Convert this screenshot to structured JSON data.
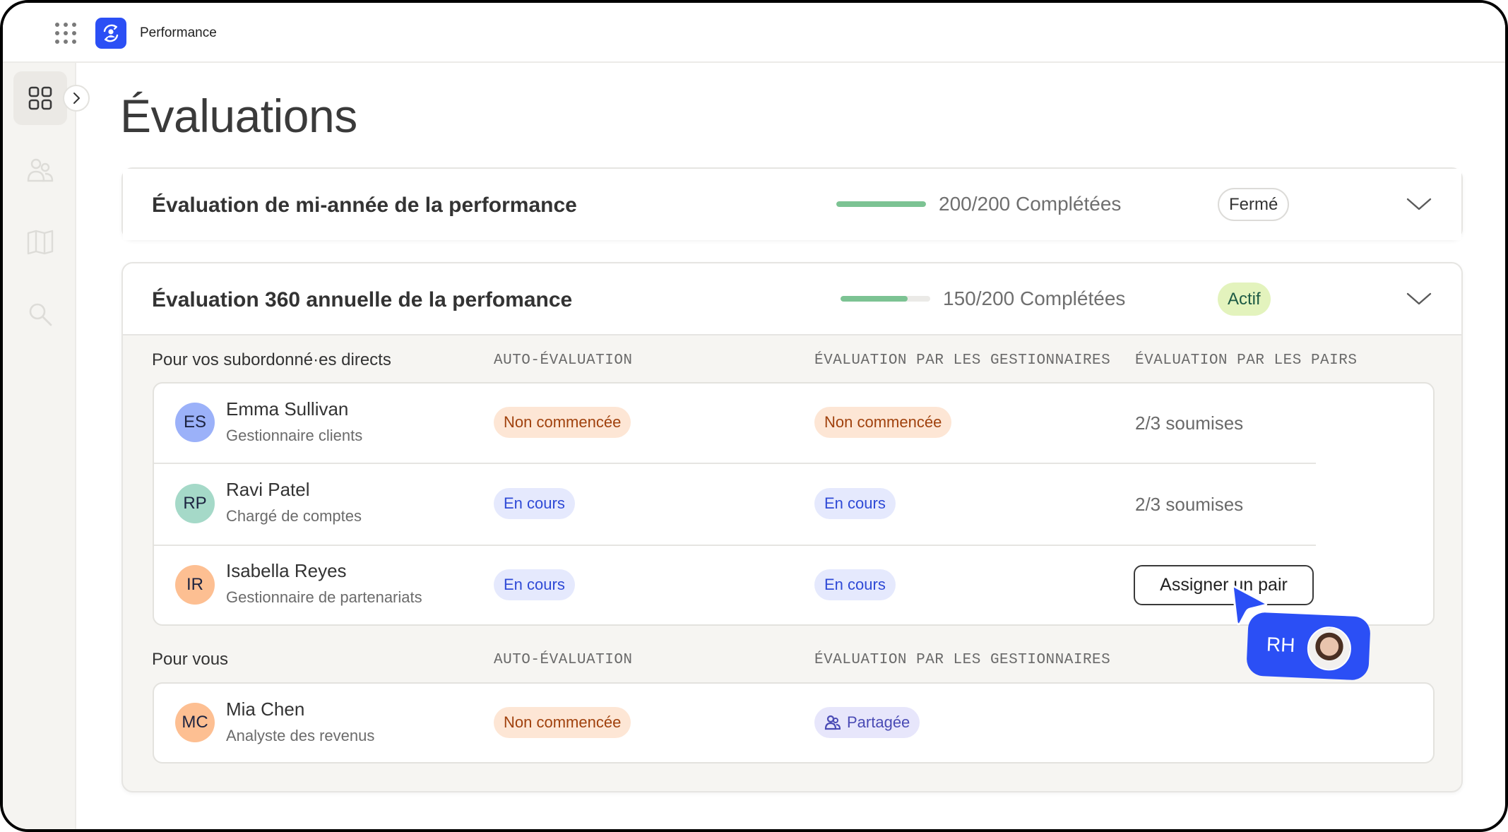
{
  "app": {
    "name": "Performance",
    "brand_color": "#2b4ff5"
  },
  "sidebar": {
    "items": [
      {
        "icon": "grid-icon",
        "active": true
      },
      {
        "icon": "people-icon",
        "active": false
      },
      {
        "icon": "book-icon",
        "active": false
      },
      {
        "icon": "search-icon",
        "active": false
      }
    ],
    "expand_icon": "chevron-right-icon"
  },
  "page": {
    "title": "Évaluations"
  },
  "reviews": [
    {
      "title": "Évaluation de mi-année de la performance",
      "completed": 200,
      "total": 200,
      "progress_label": "200/200 Complétées",
      "status": "Fermé",
      "expanded": false
    },
    {
      "title": "Évaluation 360 annuelle de la perfomance",
      "completed": 150,
      "total": 200,
      "progress_label": "150/200 Complétées",
      "status": "Actif",
      "expanded": true,
      "sections": [
        {
          "label": "Pour vos subordonné·es directs",
          "columns": [
            "AUTO-ÉVALUATION",
            "ÉVALUATION PAR LES GESTIONNAIRES",
            "ÉVALUATION PAR LES PAIRS"
          ],
          "rows": [
            {
              "initials": "ES",
              "name": "Emma Sullivan",
              "role": "Gestionnaire clients",
              "avatar_color": "#9bb1f9",
              "self": "Non commencée",
              "manager": "Non commencée",
              "peer": "2/3 soumises"
            },
            {
              "initials": "RP",
              "name": "Ravi Patel",
              "role": "Chargé de comptes",
              "avatar_color": "#a5d9c8",
              "self": "En cours",
              "manager": "En cours",
              "peer": "2/3 soumises"
            },
            {
              "initials": "IR",
              "name": "Isabella Reyes",
              "role": "Gestionnaire de partenariats",
              "avatar_color": "#fdbf92",
              "self": "En cours",
              "manager": "En cours",
              "peer_button": "Assigner un pair"
            }
          ]
        },
        {
          "label": "Pour vous",
          "columns": [
            "AUTO-ÉVALUATION",
            "ÉVALUATION PAR LES GESTIONNAIRES"
          ],
          "rows": [
            {
              "initials": "MC",
              "name": "Mia Chen",
              "role": "Analyste des revenus",
              "avatar_color": "#fdbf92",
              "self": "Non commencée",
              "manager": "Partagée"
            }
          ]
        }
      ]
    }
  ],
  "collaborator": {
    "initials": "RH"
  }
}
